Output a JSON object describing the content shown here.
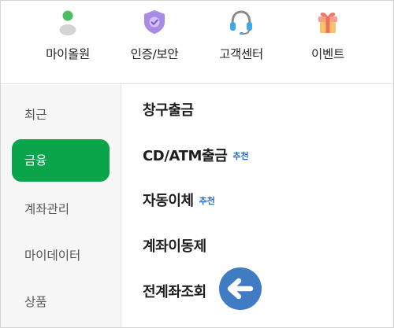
{
  "quick_menu": [
    {
      "label": "마이올원",
      "icon": "person-icon"
    },
    {
      "label": "인증/보안",
      "icon": "shield-check-icon"
    },
    {
      "label": "고객센터",
      "icon": "headset-icon"
    },
    {
      "label": "이벤트",
      "icon": "gift-icon"
    }
  ],
  "sidebar": {
    "items": [
      {
        "label": "최근"
      },
      {
        "label": "금융"
      },
      {
        "label": "계좌관리"
      },
      {
        "label": "마이데이터"
      },
      {
        "label": "상품"
      }
    ],
    "active_index": 1
  },
  "content": {
    "items": [
      {
        "title": "창구출금",
        "badge": ""
      },
      {
        "title": "CD/ATM출금",
        "badge": "추천"
      },
      {
        "title": "자동이체",
        "badge": "추천"
      },
      {
        "title": "계좌이동제",
        "badge": ""
      },
      {
        "title": "전계좌조회",
        "badge": ""
      }
    ]
  },
  "colors": {
    "accent_green": "#0aa54a",
    "badge_blue": "#1f6fd1",
    "pointer_blue": "#3f7cc4"
  },
  "pointer": {
    "icon": "left-arrow-icon"
  }
}
